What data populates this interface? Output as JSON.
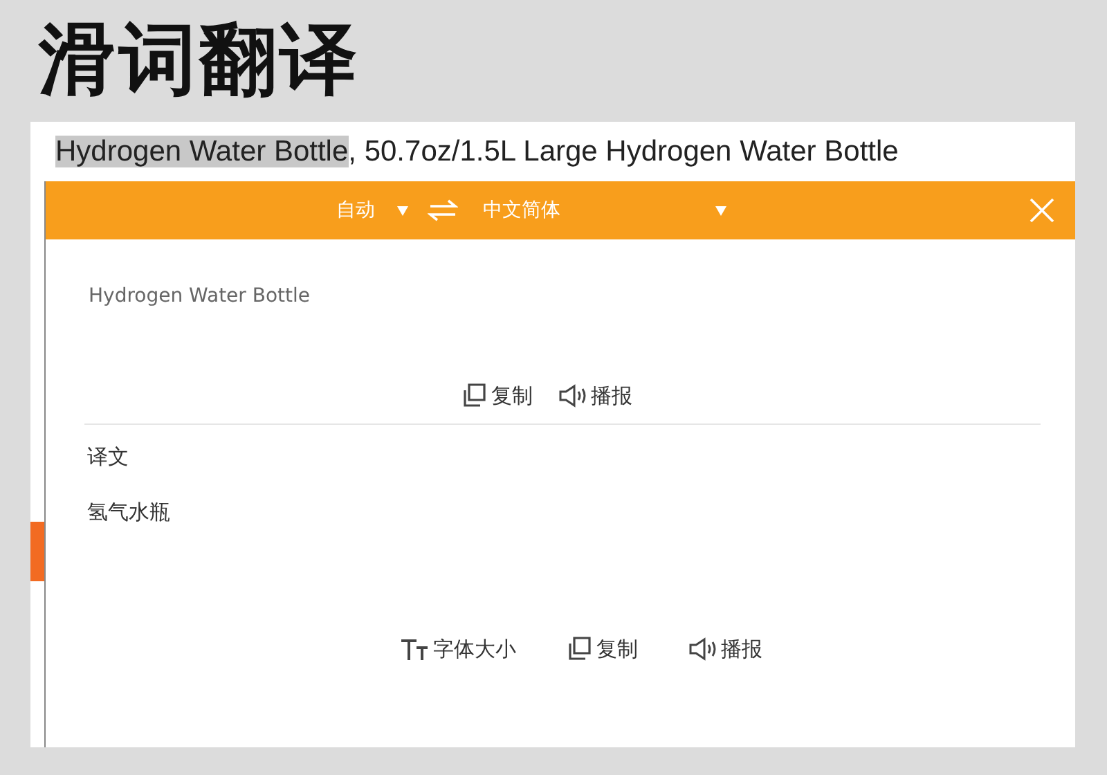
{
  "title": "滑词翻译",
  "page_line": {
    "selection": "Hydrogen Water Bottle",
    "rest": ", 50.7oz/1.5L Large Hydrogen Water Bottle"
  },
  "popup": {
    "source_language": "自动",
    "target_language": "中文简体",
    "source_text": "Hydrogen Water Bottle",
    "source_actions": [
      {
        "kind": "copy",
        "label": "复制"
      },
      {
        "kind": "speak",
        "label": "播报"
      }
    ],
    "result_label": "译文",
    "result_text": "氢气水瓶",
    "result_actions": [
      {
        "kind": "font-size",
        "label": "字体大小"
      },
      {
        "kind": "copy",
        "label": "复制"
      },
      {
        "kind": "speak",
        "label": "播报"
      }
    ]
  }
}
